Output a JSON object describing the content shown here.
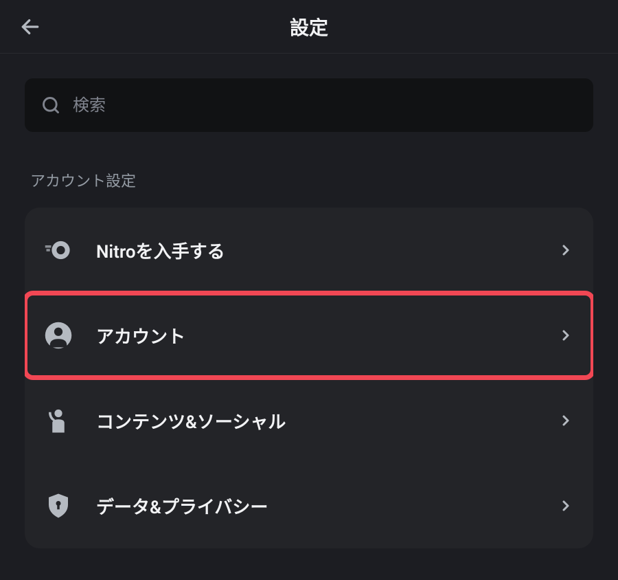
{
  "header": {
    "title": "設定"
  },
  "search": {
    "placeholder": "検索"
  },
  "section": {
    "label": "アカウント設定"
  },
  "items": [
    {
      "icon": "nitro-icon",
      "label": "Nitroを入手する",
      "highlighted": false
    },
    {
      "icon": "account-icon",
      "label": "アカウント",
      "highlighted": true
    },
    {
      "icon": "social-icon",
      "label": "コンテンツ&ソーシャル",
      "highlighted": false
    },
    {
      "icon": "privacy-icon",
      "label": "データ&プライバシー",
      "highlighted": false
    }
  ]
}
